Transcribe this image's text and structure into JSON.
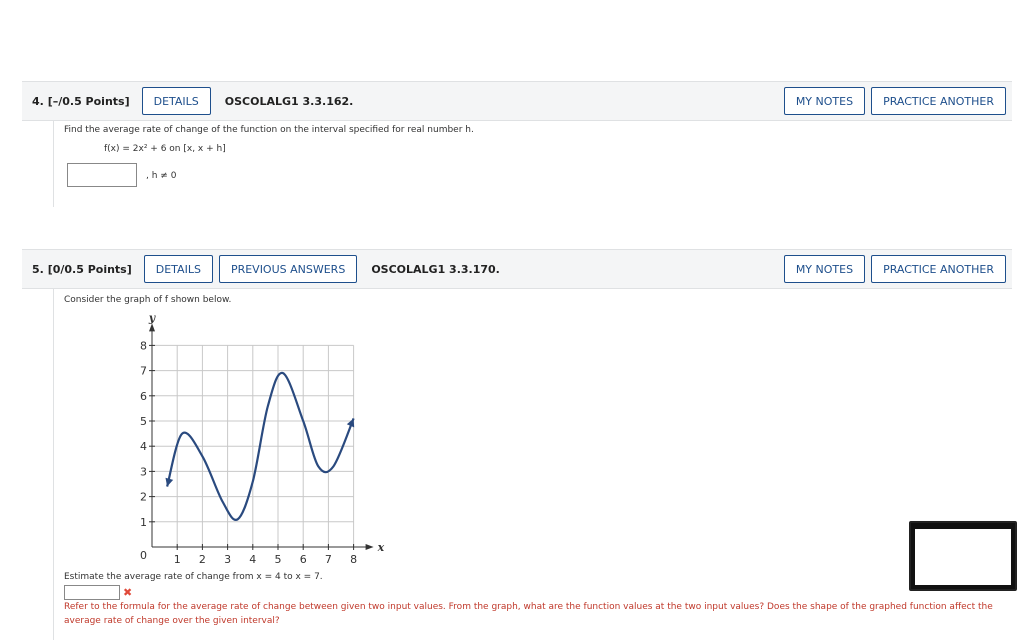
{
  "q4": {
    "number": "4.",
    "points": "[–/0.5 Points]",
    "details": "DETAILS",
    "code": "OSCOLALG1 3.3.162.",
    "my_notes": "MY NOTES",
    "practice": "PRACTICE ANOTHER",
    "prompt": "Find the average rate of change of the function on the interval specified for real number h.",
    "formula": "f(x) = 2x² + 6  on  [x, x + h]",
    "condition": ", h ≠ 0",
    "answer_value": ""
  },
  "q5": {
    "number": "5.",
    "points": "[0/0.5 Points]",
    "details": "DETAILS",
    "previous": "PREVIOUS ANSWERS",
    "code": "OSCOLALG1 3.3.170.",
    "my_notes": "MY NOTES",
    "practice": "PRACTICE ANOTHER",
    "prompt": "Consider the graph of f shown below.",
    "estimate": "Estimate the average rate of change from  x = 4  to  x = 7.",
    "answer_value": "",
    "wrong_mark": "✖",
    "hint": "Refer to the formula for the average rate of change between given two input values. From the graph, what are the function values at the two input values? Does the shape of the graphed function affect the average rate of change over the given interval?",
    "colors": {
      "hint": "#c0392b",
      "curve": "#2a4a7f",
      "button": "#1e4f8c"
    }
  },
  "chart_data": {
    "type": "line",
    "title": "",
    "xlabel": "x",
    "ylabel": "y",
    "xlim": [
      0,
      8
    ],
    "ylim": [
      0,
      8
    ],
    "x_ticks": [
      "1",
      "2",
      "3",
      "4",
      "5",
      "6",
      "7",
      "8"
    ],
    "y_ticks": [
      "1",
      "2",
      "3",
      "4",
      "5",
      "6",
      "7",
      "8"
    ],
    "origin_label": "0",
    "grid": true,
    "series": [
      {
        "x": [
          0.6,
          1.2,
          2.0,
          2.8,
          3.4,
          4.0,
          4.6,
          5.2,
          6.0,
          6.6,
          7.2,
          8.0
        ],
        "y": [
          2.4,
          4.5,
          3.6,
          1.8,
          1.1,
          2.6,
          5.6,
          6.9,
          5.0,
          3.2,
          3.2,
          5.1
        ]
      }
    ]
  }
}
